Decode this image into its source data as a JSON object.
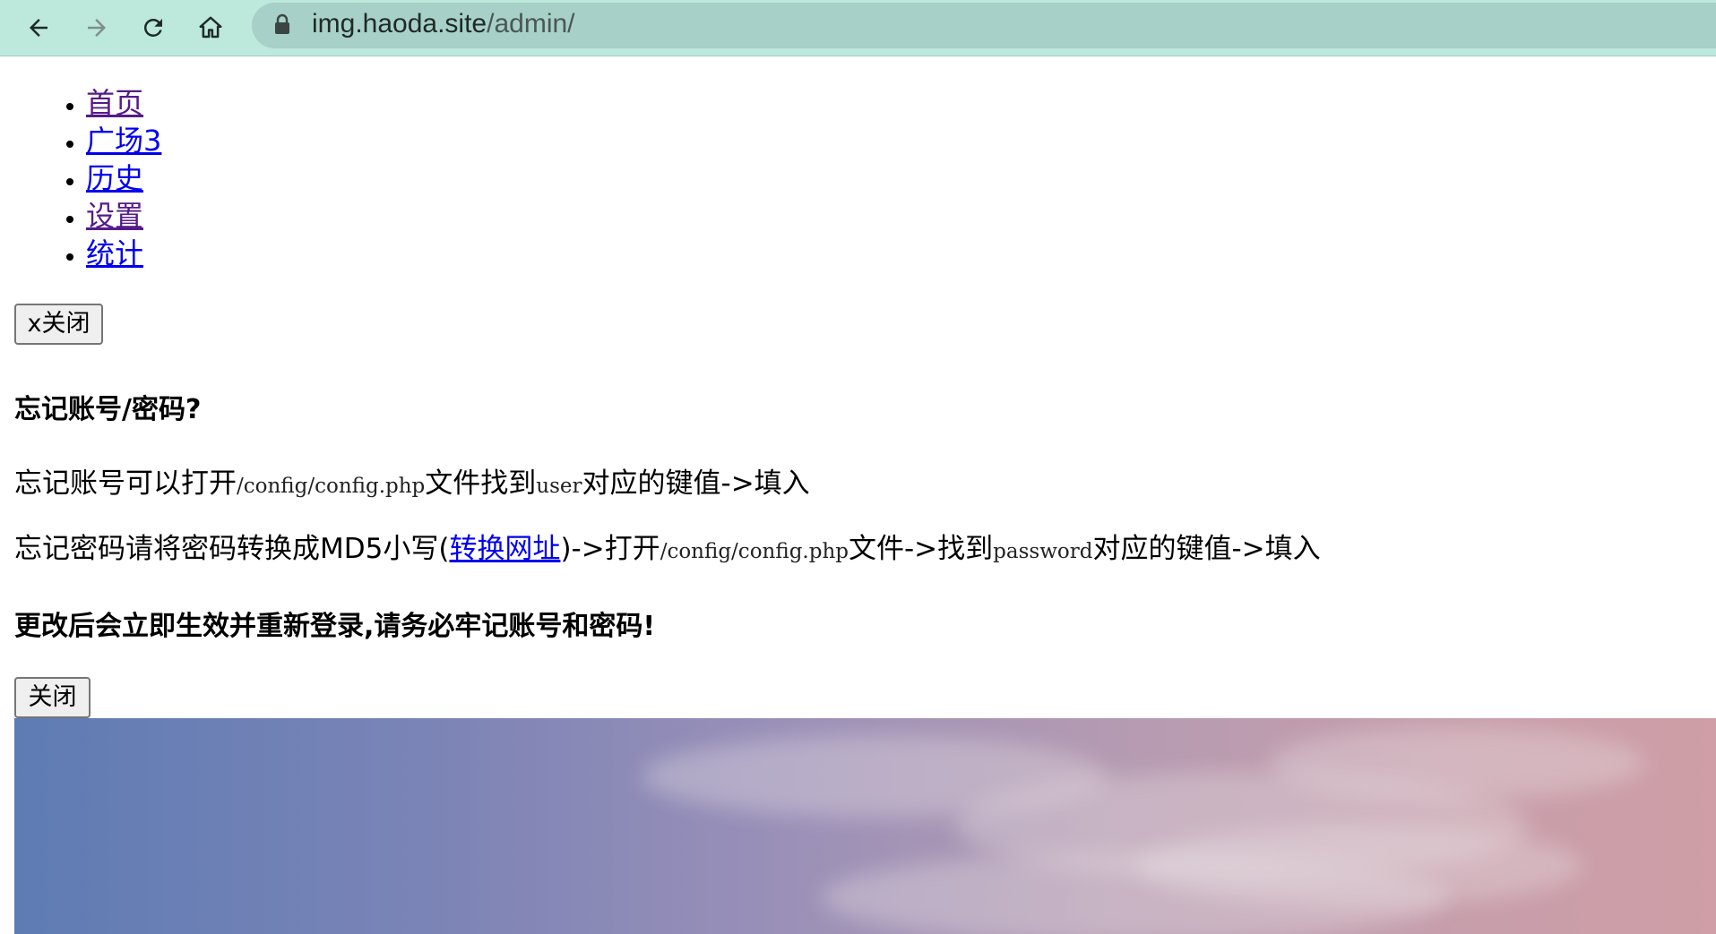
{
  "browser": {
    "url_host": "img.haoda.site",
    "url_path": "/admin/"
  },
  "nav": {
    "items": [
      {
        "label": "首页",
        "visited": true
      },
      {
        "label": "广场3",
        "visited": false
      },
      {
        "label": "历史",
        "visited": false
      },
      {
        "label": "设置",
        "visited": true
      },
      {
        "label": "统计",
        "visited": false
      }
    ]
  },
  "buttons": {
    "close_x_label": "x关闭",
    "close_label": "关闭"
  },
  "help": {
    "title": "忘记账号/密码?",
    "line1": {
      "text_a": "忘记账号可以打开",
      "code_a": "/config/config.php",
      "text_b": "文件找到",
      "code_b": "user",
      "text_c": "对应的键值->填入"
    },
    "line2": {
      "text_a": "忘记密码请将密码转换成MD5小写(",
      "link": "转换网址",
      "text_b": ")->打开",
      "code_a": "/config/config.php",
      "text_c": "文件->找到",
      "code_b": "password",
      "text_d": "对应的键值->填入"
    },
    "warning": "更改后会立即生效并重新登录,请务必牢记账号和密码!"
  },
  "icons": {
    "back": "arrow-left-icon",
    "forward": "arrow-right-icon",
    "reload": "reload-icon",
    "home": "home-icon",
    "lock": "lock-icon"
  },
  "colors": {
    "toolbar": "#bde8dc",
    "address_bar": "#a7d0c8",
    "link_unvisited": "#0000ee",
    "link_visited": "#551a8b"
  }
}
